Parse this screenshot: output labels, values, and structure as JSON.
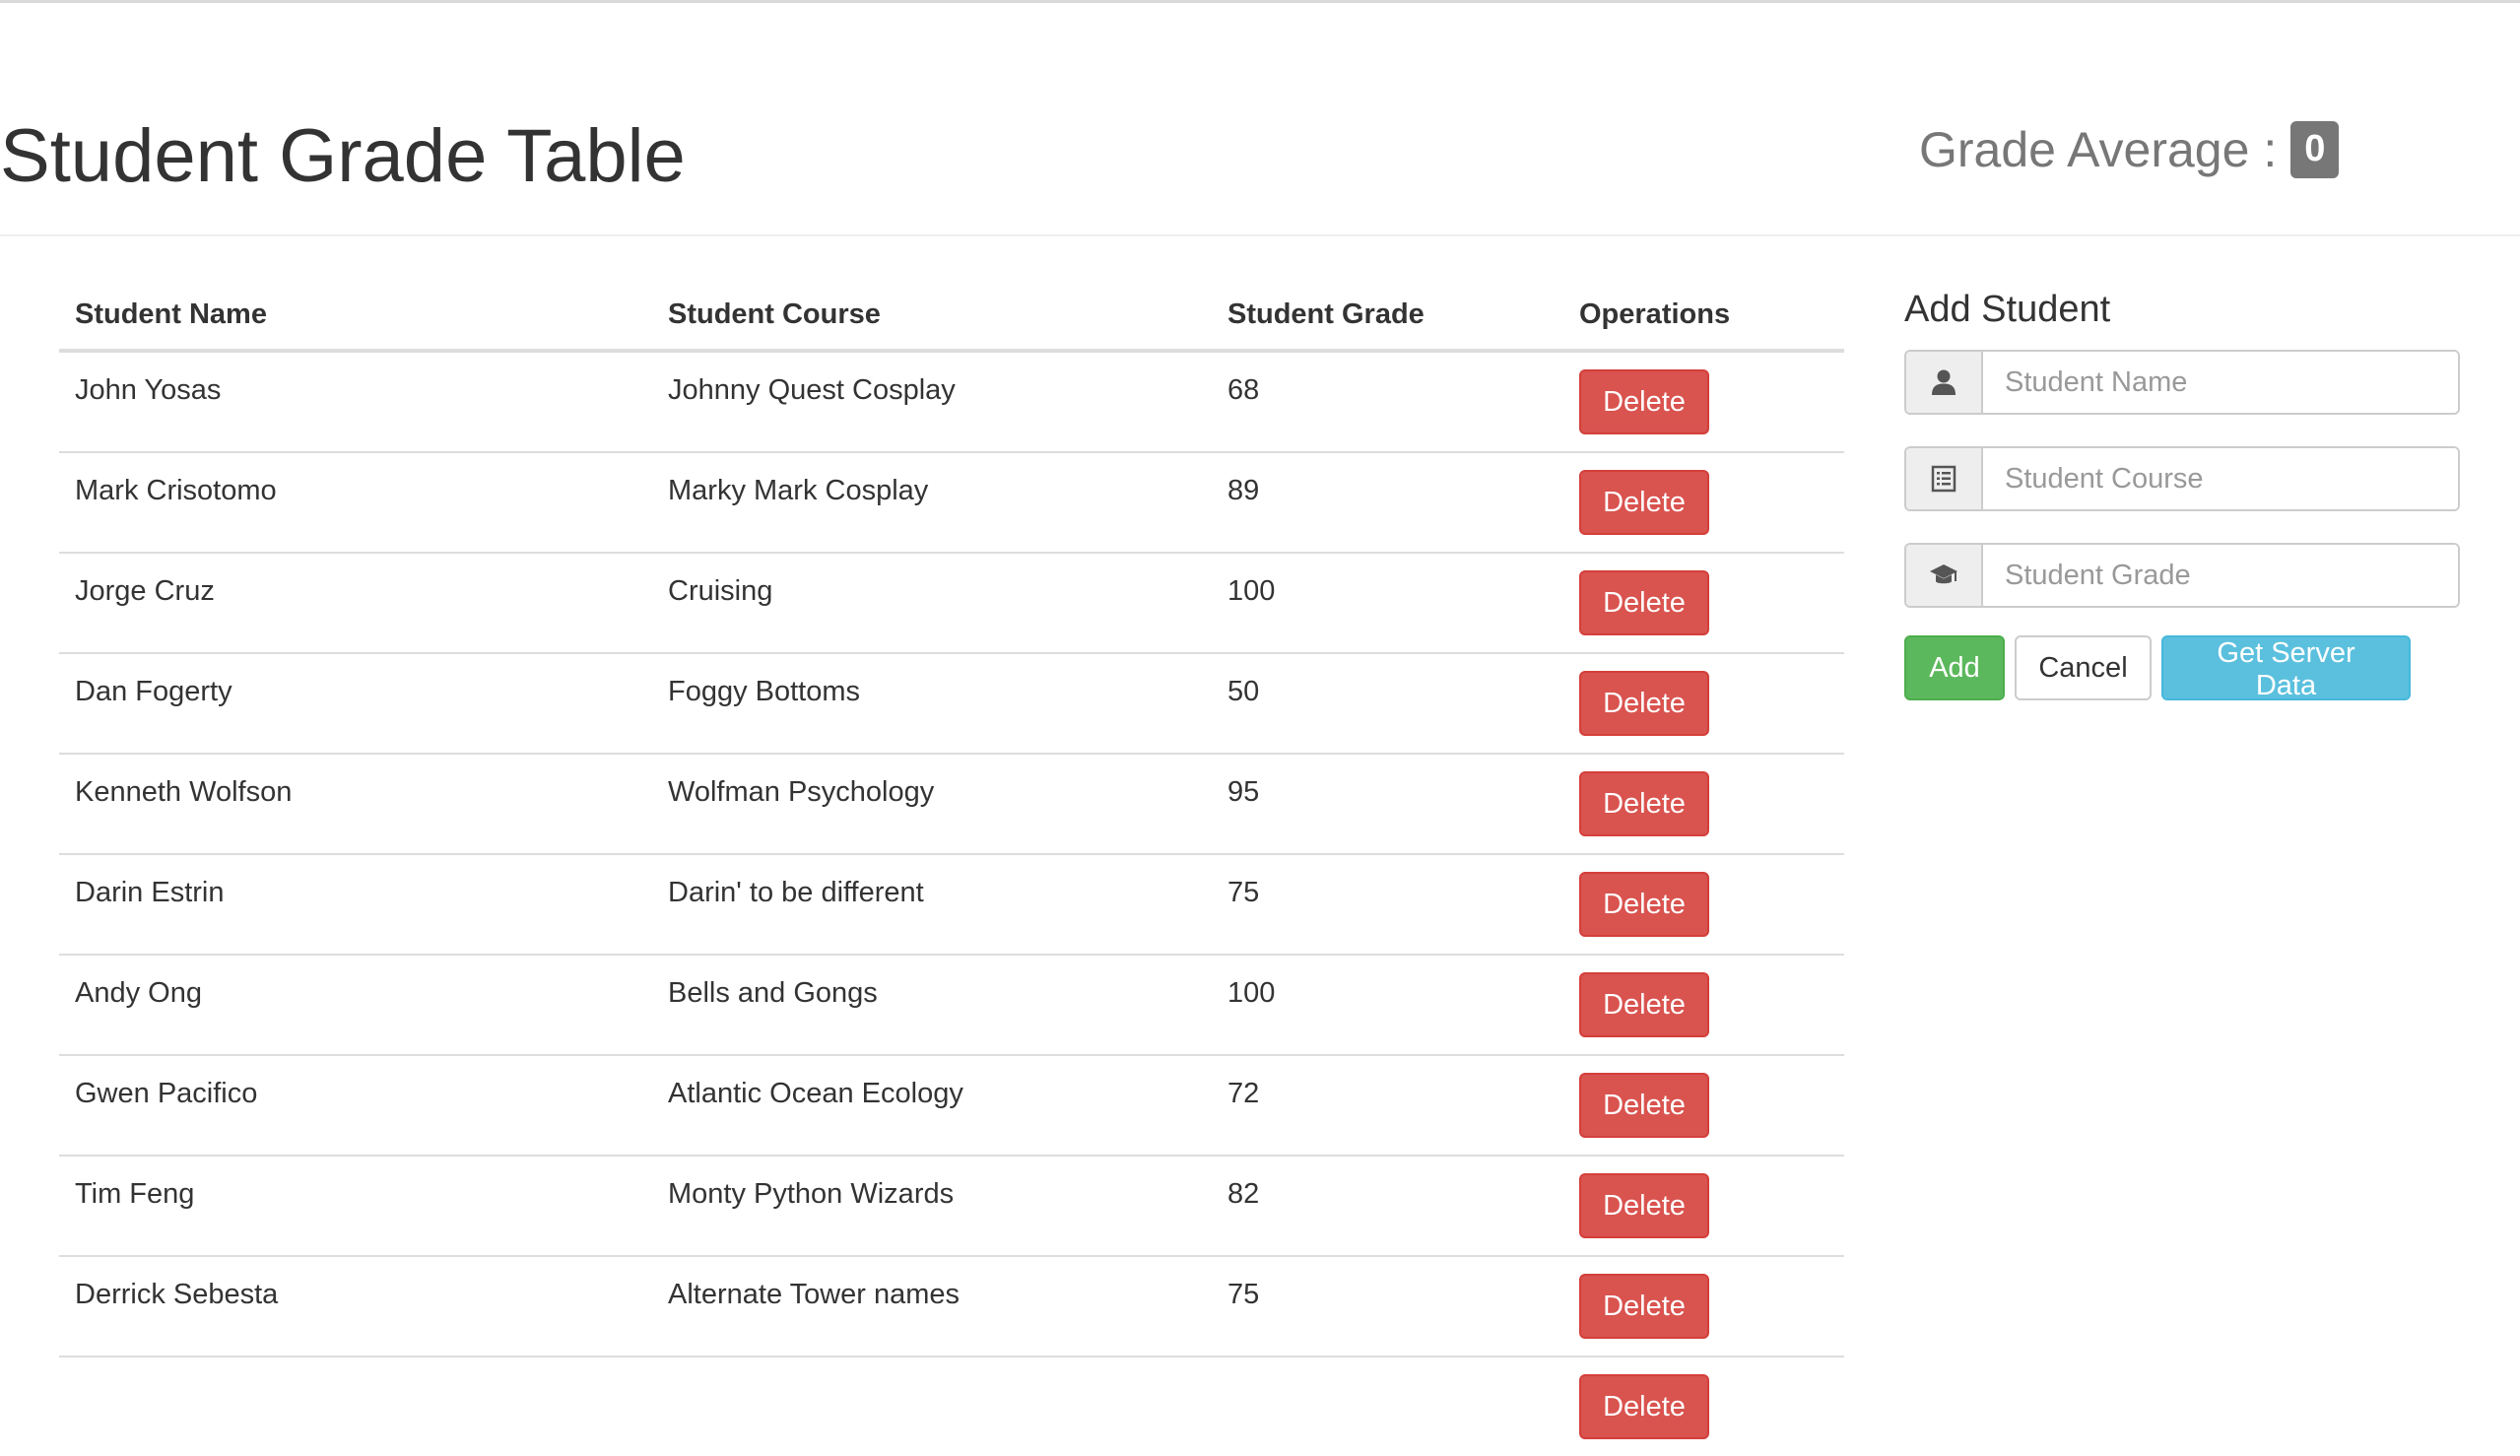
{
  "header": {
    "title": "Student Grade Table",
    "average_label": "Grade Average :",
    "average_value": "0"
  },
  "table": {
    "columns": [
      "Student Name",
      "Student Course",
      "Student Grade",
      "Operations"
    ],
    "delete_label": "Delete",
    "rows": [
      {
        "name": "John Yosas",
        "course": "Johnny Quest Cosplay",
        "grade": "68"
      },
      {
        "name": "Mark Crisotomo",
        "course": "Marky Mark Cosplay",
        "grade": "89"
      },
      {
        "name": "Jorge Cruz",
        "course": "Cruising",
        "grade": "100"
      },
      {
        "name": "Dan Fogerty",
        "course": "Foggy Bottoms",
        "grade": "50"
      },
      {
        "name": "Kenneth Wolfson",
        "course": "Wolfman Psychology",
        "grade": "95"
      },
      {
        "name": "Darin Estrin",
        "course": "Darin' to be different",
        "grade": "75"
      },
      {
        "name": "Andy Ong",
        "course": "Bells and Gongs",
        "grade": "100"
      },
      {
        "name": "Gwen Pacifico",
        "course": "Atlantic Ocean Ecology",
        "grade": "72"
      },
      {
        "name": "Tim Feng",
        "course": "Monty Python Wizards",
        "grade": "82"
      },
      {
        "name": "Derrick Sebesta",
        "course": "Alternate Tower names",
        "grade": "75"
      },
      {
        "name": "",
        "course": "",
        "grade": ""
      }
    ]
  },
  "form": {
    "title": "Add Student",
    "fields": [
      {
        "placeholder": "Student Name",
        "icon": "user-icon"
      },
      {
        "placeholder": "Student Course",
        "icon": "list-icon"
      },
      {
        "placeholder": "Student Grade",
        "icon": "graduation-cap-icon"
      }
    ],
    "add_label": "Add",
    "cancel_label": "Cancel",
    "server_label": "Get Server Data"
  },
  "colors": {
    "delete": "#d9534f",
    "add": "#5cb85c",
    "server": "#5bc0de",
    "badge": "#777777"
  }
}
